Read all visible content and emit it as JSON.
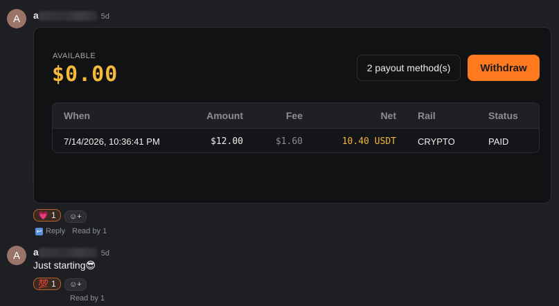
{
  "messages": [
    {
      "avatar_letter": "A",
      "username_visible": "a",
      "time": "5d",
      "reactions": [
        {
          "emoji": "💗",
          "count": "1"
        }
      ],
      "add_reaction_label": "☺+",
      "reply_label": "Reply",
      "read_by": "Read by 1"
    },
    {
      "avatar_letter": "A",
      "username_visible": "a",
      "time": "5d",
      "text": "Just starting😎",
      "reactions": [
        {
          "emoji": "💯",
          "count": "1"
        }
      ],
      "add_reaction_label": "☺+",
      "read_by": "Read by 1"
    }
  ],
  "card": {
    "available_label": "AVAILABLE",
    "balance": "$0.00",
    "payout_methods_label": "2 payout method(s)",
    "withdraw_label": "Withdraw",
    "columns": [
      "When",
      "Amount",
      "Fee",
      "Net",
      "Rail",
      "Status"
    ],
    "rows": [
      {
        "when": "7/14/2026, 10:36:41 PM",
        "amount": "$12.00",
        "fee": "$1.60",
        "net": "10.40 USDT",
        "rail": "CRYPTO",
        "status": "PAID"
      }
    ]
  },
  "colors": {
    "accent_gold": "#f5b93c",
    "withdraw_orange": "#ff7a1f",
    "background": "#1e1f22"
  }
}
